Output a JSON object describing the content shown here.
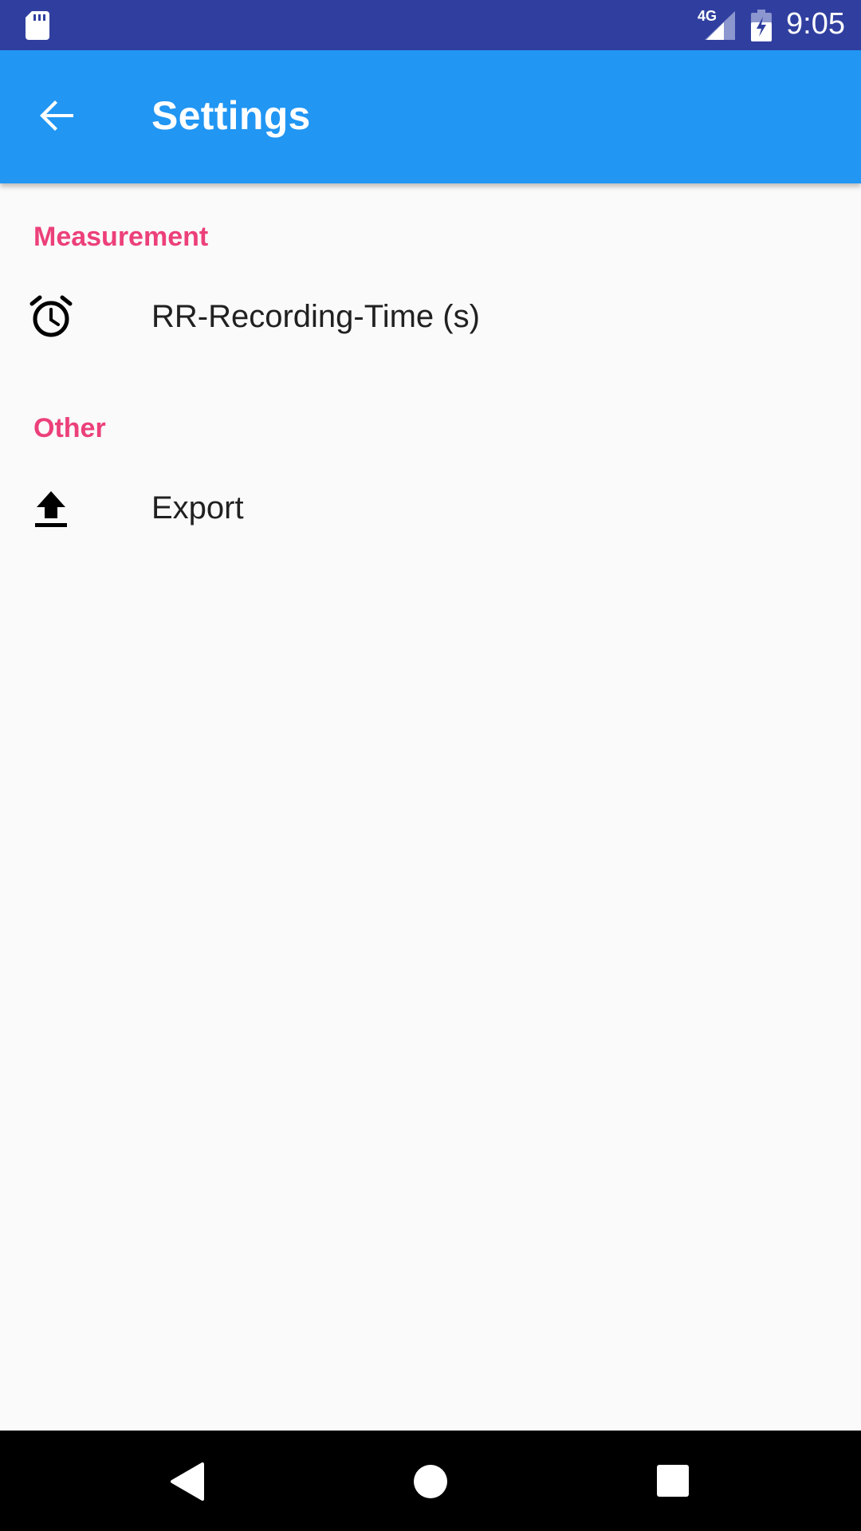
{
  "status_bar": {
    "network": "4G",
    "time": "9:05",
    "icons": [
      "sd-card-icon",
      "signal-icon",
      "battery-charging-icon"
    ]
  },
  "app_bar": {
    "title": "Settings",
    "back_icon": "arrow-back-icon"
  },
  "categories": [
    {
      "title": "Measurement",
      "items": [
        {
          "label": "RR-Recording-Time (s)",
          "icon": "alarm-icon"
        }
      ]
    },
    {
      "title": "Other",
      "items": [
        {
          "label": "Export",
          "icon": "upload-icon"
        }
      ]
    }
  ],
  "nav_bar": {
    "buttons": [
      "back-triangle-icon",
      "home-circle-icon",
      "recents-square-icon"
    ]
  },
  "colors": {
    "status_bar": "#303f9f",
    "app_bar": "#2196f3",
    "category_text": "#ec407a",
    "background": "#fafafa"
  }
}
